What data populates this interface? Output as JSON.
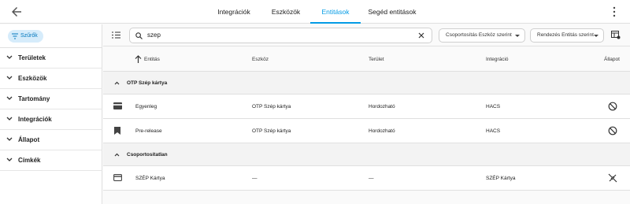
{
  "topbar": {
    "tabs": [
      {
        "label": "Integrációk",
        "active": false
      },
      {
        "label": "Eszközök",
        "active": false
      },
      {
        "label": "Entitások",
        "active": true
      },
      {
        "label": "Segéd entitások",
        "active": false
      }
    ]
  },
  "sidebar": {
    "filter_chip": "Szűrők",
    "sections": [
      {
        "label": "Területek"
      },
      {
        "label": "Eszközök"
      },
      {
        "label": "Tartomány"
      },
      {
        "label": "Integrációk"
      },
      {
        "label": "Állapot"
      },
      {
        "label": "Címkék"
      }
    ]
  },
  "toolbar": {
    "search_value": "szep",
    "group_by": "Csoportosítás Eszköz szerint",
    "sort_by": "Rendezés Entitás szerint"
  },
  "table": {
    "columns": [
      "Entitás",
      "Eszköz",
      "Terület",
      "Integráció",
      "Állapot"
    ],
    "groups": [
      {
        "title": "OTP Szép kártya",
        "rows": [
          {
            "icon": "credit-card-icon",
            "entity": "Egyenleg",
            "device": "OTP Szép kártya",
            "area": "Hordozható",
            "integration": "HACS",
            "status": "disabled-icon"
          },
          {
            "icon": "bookmark-icon",
            "entity": "Pre-release",
            "device": "OTP Szép kártya",
            "area": "Hordozható",
            "integration": "HACS",
            "status": "disabled-icon"
          }
        ]
      },
      {
        "title": "Csoportosítatlan",
        "rows": [
          {
            "icon": "credit-card-outline-icon",
            "entity": "SZÉP Kártya",
            "device": "—",
            "area": "—",
            "integration": "SZÉP Kártya",
            "status": "unavailable-icon"
          }
        ]
      }
    ]
  },
  "colors": {
    "accent": "#039be5",
    "chip_bg": "#d6ecfb"
  }
}
